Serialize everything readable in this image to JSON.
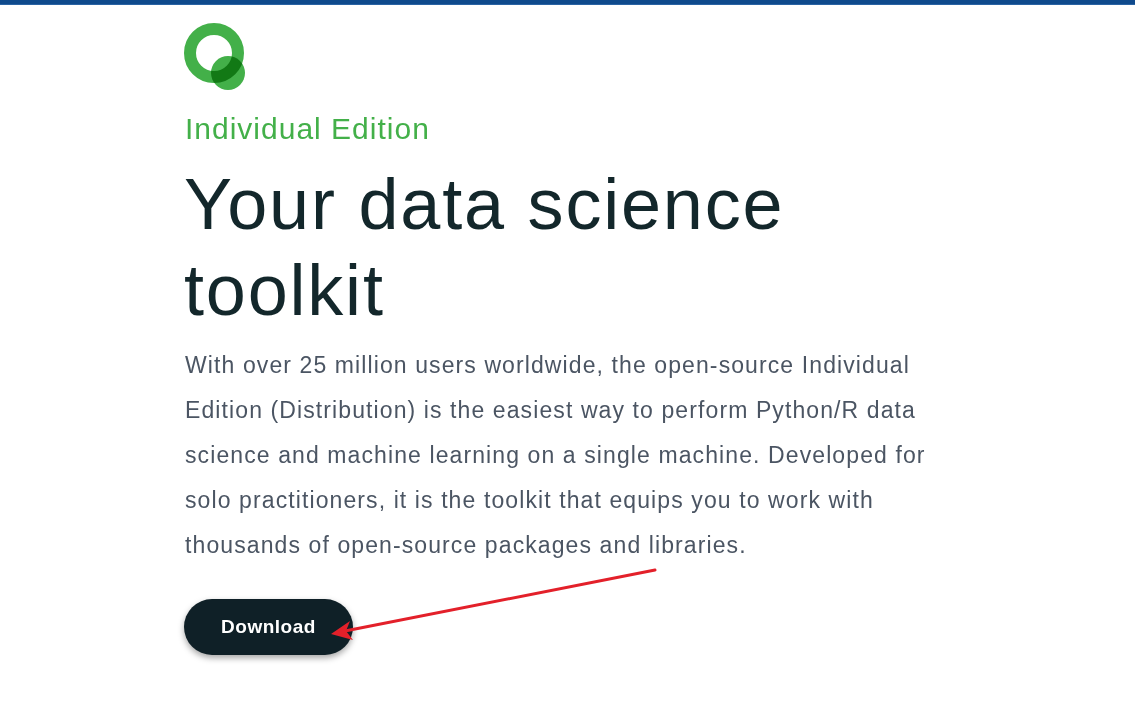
{
  "hero": {
    "edition_label": "Individual Edition",
    "title": "Your data science toolkit",
    "description": "With over 25 million users worldwide, the open-source Individual Edition (Distribution) is the easiest way to perform Python/R data science and machine learning on a single machine. Developed for solo practitioners, it is the toolkit that equips you to work with thousands of open-source packages and libraries.",
    "download_button": "Download"
  }
}
